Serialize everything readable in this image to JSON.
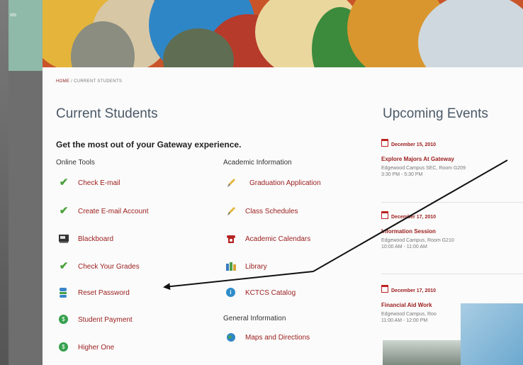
{
  "frame": {
    "edge_text": "sts"
  },
  "breadcrumb": {
    "home": "HOME",
    "separator": " / ",
    "current": "CURRENT STUDENTS"
  },
  "page": {
    "title": "Current Students",
    "tagline": "Get the most out of your Gateway experience."
  },
  "online_tools": {
    "heading": "Online Tools",
    "items": [
      {
        "label": "Check E-mail",
        "icon": "check-icon"
      },
      {
        "label": "Create E-mail Account",
        "icon": "check-icon"
      },
      {
        "label": "Blackboard",
        "icon": "blackboard-icon"
      },
      {
        "label": "Check Your Grades",
        "icon": "check-icon"
      },
      {
        "label": "Reset Password",
        "icon": "reset-icon"
      },
      {
        "label": "Student Payment",
        "icon": "dollar-icon"
      },
      {
        "label": "Higher One",
        "icon": "dollar-icon"
      }
    ]
  },
  "academic_info": {
    "heading": "Academic Information",
    "items": [
      {
        "label": "Graduation Application",
        "icon": "pencil-icon"
      },
      {
        "label": "Class Schedules",
        "icon": "pencil-icon"
      },
      {
        "label": "Academic Calendars",
        "icon": "phone-icon"
      },
      {
        "label": "Library",
        "icon": "library-icon"
      },
      {
        "label": "KCTCS Catalog",
        "icon": "info-icon"
      }
    ]
  },
  "general_info": {
    "heading": "General Information",
    "items": [
      {
        "label": "Maps and Directions",
        "icon": "globe-icon"
      }
    ]
  },
  "events": {
    "title": "Upcoming Events",
    "items": [
      {
        "date": "December 15, 2010",
        "title": "Explore Majors At Gateway",
        "location": "Edgewood Campus SEC, Room G209",
        "time": "3:30 PM - 5:30 PM"
      },
      {
        "date": "December 17, 2010",
        "title": "Information Session",
        "location": "Edgewood Campus, Room G210",
        "time": "10:00 AM - 11:00 AM"
      },
      {
        "date": "December 17, 2010",
        "title": "Financial Aid Work",
        "location": "Edgewood Campus, Roo",
        "time": "11:00 AM - 12:00 PM"
      }
    ]
  },
  "colors": {
    "link": "#9b1c1c",
    "heading": "#4a5967",
    "check": "#49a23a"
  }
}
